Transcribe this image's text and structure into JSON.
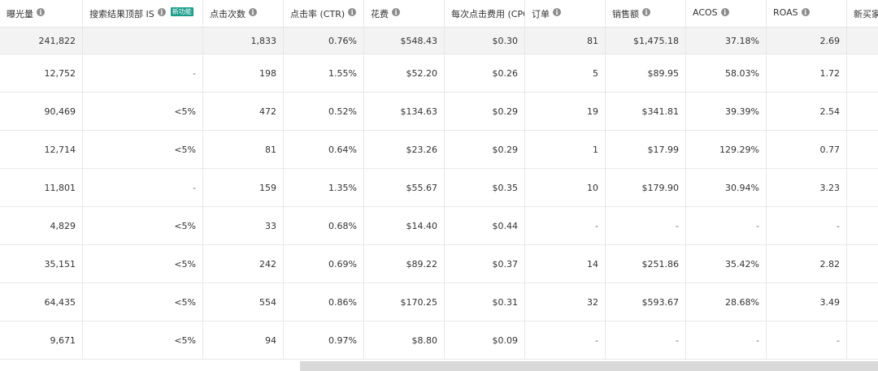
{
  "headers": [
    {
      "label": "曝光量",
      "info": true
    },
    {
      "label": "搜索结果顶部 IS",
      "info": true,
      "badge": "新功能"
    },
    {
      "label": "点击次数",
      "info": true
    },
    {
      "label": "点击率 (CTR)",
      "info": true
    },
    {
      "label": "花费",
      "info": true
    },
    {
      "label": "每次点击费用 (CPC)",
      "info": false
    },
    {
      "label": "订单",
      "info": true
    },
    {
      "label": "销售额",
      "info": true
    },
    {
      "label": "ACOS",
      "info": true
    },
    {
      "label": "ROAS",
      "info": true
    },
    {
      "label": "新买家",
      "info": false
    }
  ],
  "summary": [
    "241,822",
    "",
    "1,833",
    "0.76%",
    "$548.43",
    "$0.30",
    "81",
    "$1,475.18",
    "37.18%",
    "2.69",
    ""
  ],
  "rows": [
    [
      "12,752",
      "-",
      "198",
      "1.55%",
      "$52.20",
      "$0.26",
      "5",
      "$89.95",
      "58.03%",
      "1.72",
      ""
    ],
    [
      "90,469",
      "<5%",
      "472",
      "0.52%",
      "$134.63",
      "$0.29",
      "19",
      "$341.81",
      "39.39%",
      "2.54",
      ""
    ],
    [
      "12,714",
      "<5%",
      "81",
      "0.64%",
      "$23.26",
      "$0.29",
      "1",
      "$17.99",
      "129.29%",
      "0.77",
      ""
    ],
    [
      "11,801",
      "-",
      "159",
      "1.35%",
      "$55.67",
      "$0.35",
      "10",
      "$179.90",
      "30.94%",
      "3.23",
      ""
    ],
    [
      "4,829",
      "<5%",
      "33",
      "0.68%",
      "$14.40",
      "$0.44",
      "-",
      "-",
      "-",
      "-",
      ""
    ],
    [
      "35,151",
      "<5%",
      "242",
      "0.69%",
      "$89.22",
      "$0.37",
      "14",
      "$251.86",
      "35.42%",
      "2.82",
      ""
    ],
    [
      "64,435",
      "<5%",
      "554",
      "0.86%",
      "$170.25",
      "$0.31",
      "32",
      "$593.67",
      "28.68%",
      "3.49",
      ""
    ],
    [
      "9,671",
      "<5%",
      "94",
      "0.97%",
      "$8.80",
      "$0.09",
      "-",
      "-",
      "-",
      "-",
      ""
    ]
  ],
  "icons": {
    "info": "info-icon"
  },
  "colors": {
    "badge": "#1a9e8c",
    "summary_bg": "#f3f3f3",
    "scroll_thumb": "#d9d9d9"
  }
}
